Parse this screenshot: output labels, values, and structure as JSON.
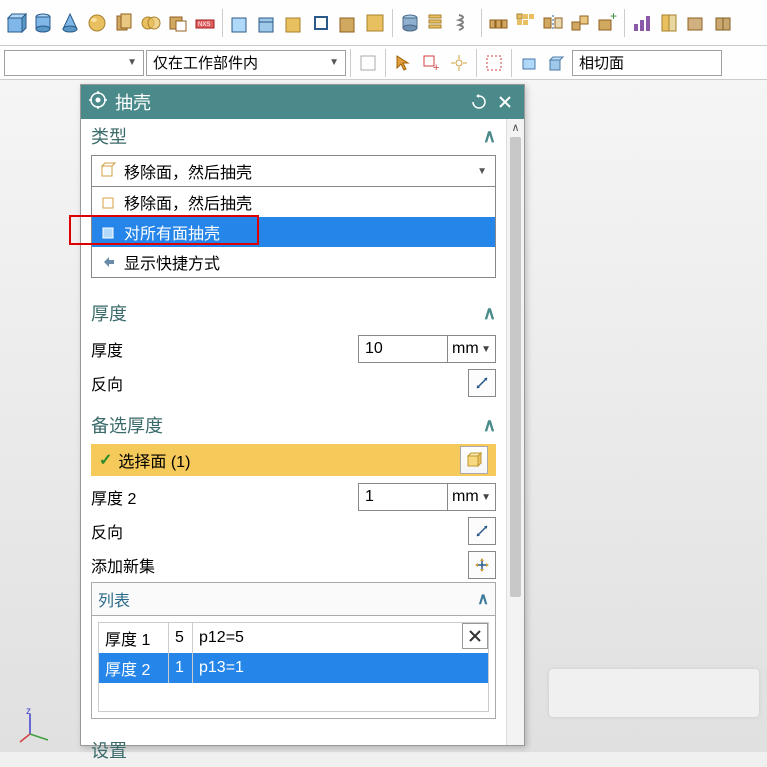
{
  "toolbar2": {
    "filter_label": "仅在工作部件内",
    "tangent_face": "相切面"
  },
  "dialog": {
    "title": "抽壳",
    "sections": {
      "type": {
        "label": "类型",
        "selected": "移除面，然后抽壳",
        "options": {
          "remove": "移除面，然后抽壳",
          "all": "对所有面抽壳",
          "shortcut": "显示快捷方式"
        }
      },
      "thickness": {
        "label": "厚度",
        "field_label": "厚度",
        "value": "10",
        "unit": "mm",
        "reverse_label": "反向"
      },
      "alt_thickness": {
        "label": "备选厚度",
        "select_face": "选择面 (1)",
        "field_label": "厚度 2",
        "value": "1",
        "unit": "mm",
        "reverse_label": "反向",
        "add_set_label": "添加新集",
        "list_label": "列表",
        "rows": [
          {
            "name": "厚度 1",
            "val": "5",
            "expr": "p12=5"
          },
          {
            "name": "厚度 2",
            "val": "1",
            "expr": "p13=1"
          }
        ]
      },
      "settings": {
        "label": "设置"
      }
    }
  }
}
